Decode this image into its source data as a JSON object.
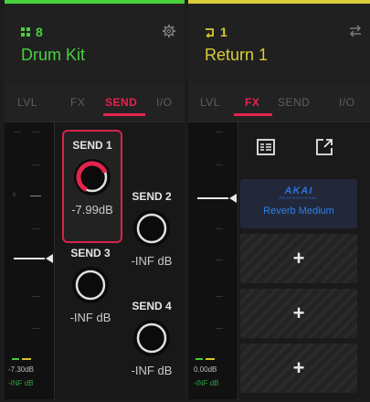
{
  "colors": {
    "drum": "#46d13d",
    "return": "#d9cc3a",
    "accent": "#e3244d",
    "akai": "#2d80e6"
  },
  "drum_track": {
    "number": "8",
    "name": "Drum Kit",
    "icons": {
      "track_type": "pads-icon",
      "settings": "gear-icon"
    },
    "tabs": [
      "LVL",
      "FX",
      "SEND",
      "I/O"
    ],
    "active_tab": "SEND",
    "meter": {
      "zero_label": "0",
      "value": "-7.30dB",
      "inf": "-INF dB"
    },
    "sends": [
      {
        "label": "SEND 1",
        "value": "-7.99dB",
        "level": 0.82
      },
      {
        "label": "SEND 2",
        "value": "-INF dB",
        "level": 0
      },
      {
        "label": "SEND 3",
        "value": "-INF dB",
        "level": 0
      },
      {
        "label": "SEND 4",
        "value": "-INF dB",
        "level": 0
      }
    ]
  },
  "return_track": {
    "number": "1",
    "name": "Return 1",
    "icons": {
      "track_type": "return-icon",
      "swap": "swap-icon"
    },
    "tabs": [
      "LVL",
      "FX",
      "SEND",
      "I/O"
    ],
    "active_tab": "FX",
    "meter": {
      "value": "0.00dB",
      "inf": "-INF dB"
    },
    "fx_toolbar": {
      "list": "list-icon",
      "open": "open-external-icon"
    },
    "plugins": [
      {
        "brand": "AKAI",
        "brand_sub": "PROFESSIONAL",
        "name": "Reverb Medium"
      },
      {
        "empty": "+"
      },
      {
        "empty": "+"
      },
      {
        "empty": "+"
      }
    ]
  }
}
